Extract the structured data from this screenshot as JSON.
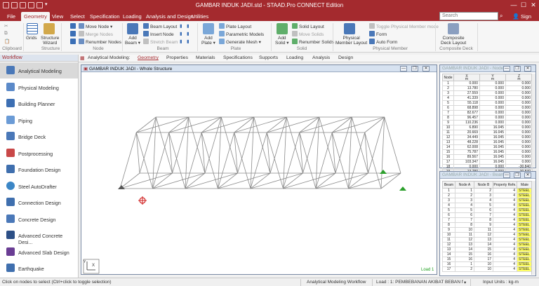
{
  "app": {
    "title": "GAMBAR INDUK JADI.std - STAAD.Pro CONNECT Edition"
  },
  "colors": {
    "brand": "#a42a2e",
    "structure": "#8a8a8a",
    "support": "#2ca02c",
    "load_text": "#1a9e1a"
  },
  "menu": {
    "tabs": [
      "File",
      "Geometry",
      "View",
      "Select",
      "Specification",
      "Loading",
      "Analysis and Design",
      "Utilities"
    ],
    "active": "Geometry",
    "search_placeholder": "Search",
    "signin": "Sign in"
  },
  "ribbon": {
    "groups": {
      "clipboard": "Clipboard",
      "structure": "Structure",
      "node": "Node",
      "beam": "Beam",
      "plate": "Plate",
      "solid": "Solid",
      "physical": "Physical Member",
      "composite": "Composite Deck"
    },
    "grids": "Grids",
    "structure_wizard": [
      "Structure",
      "Wizard"
    ],
    "move_node": "Move Node",
    "merge_nodes": "Merge Nodes",
    "renumber_nodes": "Renumber Nodes",
    "add_beam": [
      "Add",
      "Beam"
    ],
    "beam_layout": "Beam Layout",
    "insert_node": "Insert Node",
    "stretch_beam": "Stretch Beam",
    "add_plate": [
      "Add",
      "Plate"
    ],
    "plate_layout": "Plate Layout",
    "parametric_models": "Parametric Models",
    "generate_mesh": "Generate Mesh",
    "add_solid": [
      "Add",
      "Solid"
    ],
    "solid_layout": "Solid Layout",
    "move_solids": "Move Solids",
    "renumber_solids": "Renumber Solids",
    "physical_member_layout": [
      "Physical",
      "Member Layout"
    ],
    "toggle_physical": "Toggle Physical Member mode",
    "form": "Form",
    "auto_form": "Auto Form",
    "composite_deck_layout": [
      "Composite",
      "Deck Layout"
    ]
  },
  "workflow": {
    "header": "Workflow",
    "items": [
      "Analytical Modeling",
      "Physical Modeling",
      "Building Planner",
      "Piping",
      "Bridge Deck",
      "Postprocessing",
      "Foundation Design",
      "Steel AutoDrafter",
      "Connection Design",
      "Concrete Design",
      "Advanced Concrete Desi...",
      "Advanced Slab Design",
      "Earthquake"
    ],
    "active": "Analytical Modeling"
  },
  "subtabs": {
    "label": "Analytical Modeling:",
    "items": [
      "Geometry",
      "Properties",
      "Materials",
      "Specifications",
      "Supports",
      "Loading",
      "Analysis",
      "Design"
    ],
    "active": "Geometry"
  },
  "viewport": {
    "title": "GAMBAR INDUK JADI - Whole Structure",
    "load_label": "Load 1",
    "axis_x": "X",
    "axis_y": "Y"
  },
  "nodes_table": {
    "title": "GAMBAR INDUK JADI - Nodes",
    "headers": [
      "Node",
      "X\nm",
      "Y\nm",
      "Z\nm"
    ],
    "rows": [
      [
        "1",
        "0.000",
        "0.000",
        "0.000"
      ],
      [
        "2",
        "13.780",
        "0.000",
        "0.000"
      ],
      [
        "3",
        "27.559",
        "0.000",
        "0.000"
      ],
      [
        "4",
        "41.339",
        "0.000",
        "0.000"
      ],
      [
        "5",
        "55.118",
        "0.000",
        "0.000"
      ],
      [
        "6",
        "68.898",
        "0.000",
        "0.000"
      ],
      [
        "7",
        "82.677",
        "0.000",
        "0.000"
      ],
      [
        "8",
        "96.457",
        "0.000",
        "0.000"
      ],
      [
        "9",
        "110.236",
        "0.000",
        "0.000"
      ],
      [
        "10",
        "6.890",
        "16.045",
        "0.000"
      ],
      [
        "11",
        "20.669",
        "16.045",
        "0.000"
      ],
      [
        "12",
        "34.449",
        "16.045",
        "0.000"
      ],
      [
        "13",
        "48.228",
        "16.045",
        "0.000"
      ],
      [
        "14",
        "62.008",
        "16.045",
        "0.000"
      ],
      [
        "15",
        "75.787",
        "16.045",
        "0.000"
      ],
      [
        "16",
        "89.567",
        "16.045",
        "0.000"
      ],
      [
        "17",
        "103.347",
        "16.045",
        "0.000"
      ],
      [
        "18",
        "0.000",
        "0.000",
        "-30.840"
      ],
      [
        "19",
        "13.780",
        "0.000",
        "-30.840"
      ]
    ]
  },
  "beams_table": {
    "title": "GAMBAR INDUK JADI - Beams",
    "headers": [
      "Beam",
      "Node A",
      "Node B",
      "Property Refe.",
      "Mate"
    ],
    "rows": [
      [
        "1",
        "1",
        "2",
        "4",
        "STEEL"
      ],
      [
        "2",
        "2",
        "3",
        "4",
        "STEEL"
      ],
      [
        "3",
        "3",
        "4",
        "4",
        "STEEL"
      ],
      [
        "4",
        "4",
        "5",
        "4",
        "STEEL"
      ],
      [
        "5",
        "5",
        "6",
        "4",
        "STEEL"
      ],
      [
        "6",
        "6",
        "7",
        "4",
        "STEEL"
      ],
      [
        "7",
        "7",
        "8",
        "4",
        "STEEL"
      ],
      [
        "8",
        "8",
        "9",
        "4",
        "STEEL"
      ],
      [
        "9",
        "10",
        "11",
        "4",
        "STEEL"
      ],
      [
        "10",
        "11",
        "12",
        "4",
        "STEEL"
      ],
      [
        "11",
        "12",
        "13",
        "4",
        "STEEL"
      ],
      [
        "12",
        "13",
        "14",
        "4",
        "STEEL"
      ],
      [
        "13",
        "14",
        "15",
        "4",
        "STEEL"
      ],
      [
        "14",
        "15",
        "16",
        "4",
        "STEEL"
      ],
      [
        "15",
        "16",
        "17",
        "4",
        "STEEL"
      ],
      [
        "16",
        "1",
        "10",
        "4",
        "STEEL"
      ],
      [
        "17",
        "2",
        "10",
        "4",
        "STEEL"
      ]
    ]
  },
  "status": {
    "hint": "Click on nodes to select (Ctrl+click to toggle selection)",
    "workflow": "Analytical Modeling Workflow",
    "load": "Load : 1: PEMBEBANAN AKIBAT BEBAN fr",
    "units": "Input Units : kg-m"
  }
}
